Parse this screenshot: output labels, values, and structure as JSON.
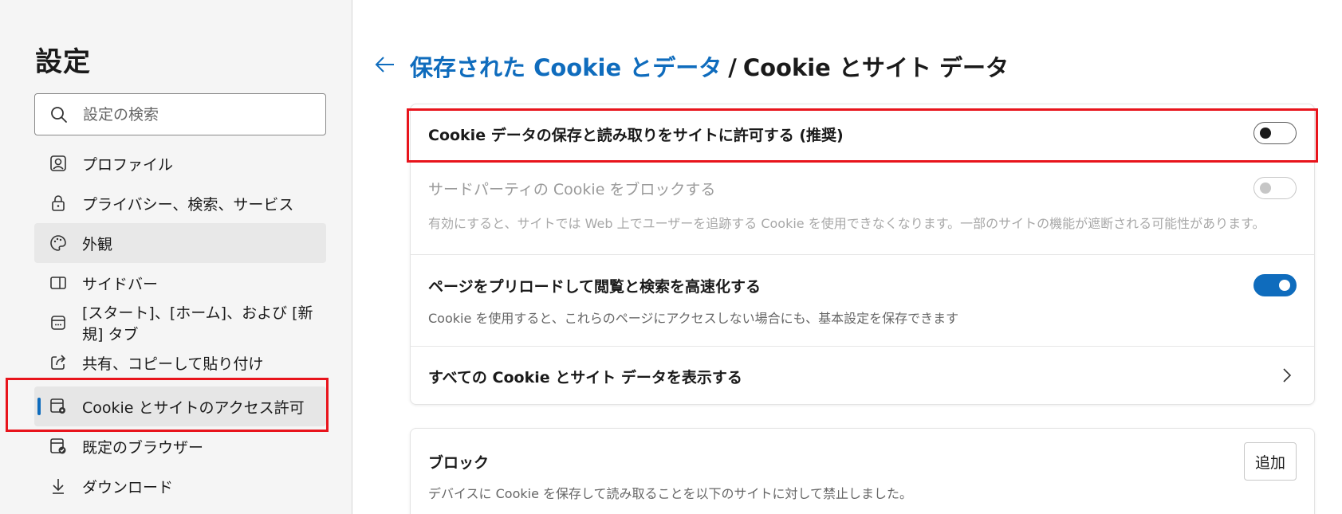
{
  "sidebar": {
    "title": "設定",
    "search_placeholder": "設定の検索",
    "items": [
      {
        "label": "プロファイル",
        "icon": "profile-icon"
      },
      {
        "label": "プライバシー、検索、サービス",
        "icon": "lock-icon"
      },
      {
        "label": "外観",
        "icon": "palette-icon"
      },
      {
        "label": "サイドバー",
        "icon": "sidebar-icon"
      },
      {
        "label": "[スタート]、[ホーム]、および [新規] タブ",
        "icon": "home-tab-icon"
      },
      {
        "label": "共有、コピーして貼り付け",
        "icon": "share-icon"
      },
      {
        "label": "Cookie とサイトのアクセス許可",
        "icon": "cookie-permissions-icon"
      },
      {
        "label": "既定のブラウザー",
        "icon": "default-browser-icon"
      },
      {
        "label": "ダウンロード",
        "icon": "download-icon"
      }
    ],
    "hovered_index": 2,
    "selected_index": 6
  },
  "header": {
    "back_icon": "back-arrow-icon",
    "breadcrumb_link": "保存された Cookie とデータ",
    "breadcrumb_separator": "/",
    "breadcrumb_current": "Cookie とサイト データ"
  },
  "settings": {
    "allow_cookies": {
      "title": "Cookie データの保存と読み取りをサイトに許可する (推奨)",
      "toggle": "off"
    },
    "block_third_party": {
      "title": "サードパーティの Cookie をブロックする",
      "description": "有効にすると、サイトでは Web 上でユーザーを追跡する Cookie を使用できなくなります。一部のサイトの機能が遮断される可能性があります。",
      "toggle": "disabled"
    },
    "preload_pages": {
      "title": "ページをプリロードして閲覧と検索を高速化する",
      "description": "Cookie を使用すると、これらのページにアクセスしない場合にも、基本設定を保存できます",
      "toggle": "on"
    },
    "see_all": {
      "title": "すべての Cookie とサイト データを表示する"
    }
  },
  "block_section": {
    "title": "ブロック",
    "description": "デバイスに Cookie を保存して読み取ることを以下のサイトに対して禁止しました。",
    "add_label": "追加"
  },
  "colors": {
    "accent": "#0f6cbd",
    "highlight_box": "#e8141c"
  }
}
